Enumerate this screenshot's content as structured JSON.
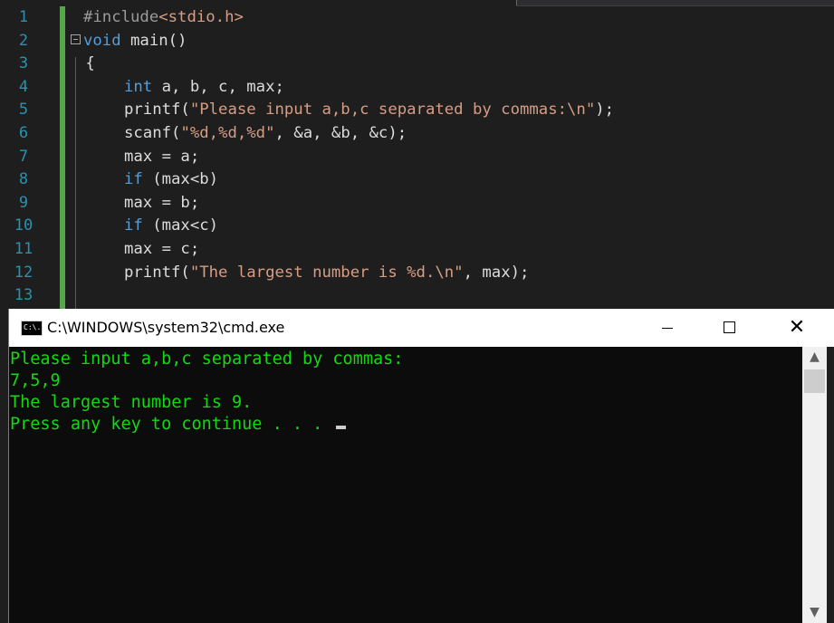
{
  "editor": {
    "line_numbers": [
      "1",
      "2",
      "3",
      "4",
      "5",
      "6",
      "7",
      "8",
      "9",
      "10",
      "11",
      "12",
      "13"
    ],
    "code": {
      "l1_directive": "#include",
      "l1_header": "<stdio.h>",
      "l2_void": "void",
      "l2_rest": " main()",
      "l3": " {",
      "l4_kw": "int",
      "l4_rest": " a, b, c, max;",
      "l5_fn": "printf(",
      "l5_str": "\"Please input a,b,c separated by commas:\\n\"",
      "l5_end": ");",
      "l6_fn": "scanf(",
      "l6_str": "\"%d,%d,%d\"",
      "l6_end": ", &a, &b, &c);",
      "l7": "max = a;",
      "l8_kw": "if",
      "l8_rest": " (max<b)",
      "l9": "max = b;",
      "l10_kw": "if",
      "l10_rest": " (max<c)",
      "l11": "max = c;",
      "l12_fn": "printf(",
      "l12_str": "\"The largest number is %d.\\n\"",
      "l12_end": ", max);",
      "l13": ""
    }
  },
  "console": {
    "title": "C:\\WINDOWS\\system32\\cmd.exe",
    "icon_text": "C:\\.",
    "minimize_icon": "minimize-icon",
    "maximize_icon": "maximize-icon",
    "close_symbol": "✕",
    "output": [
      "Please input a,b,c separated by commas:",
      "7,5,9",
      "The largest number is 9.",
      "Press any key to continue . . . "
    ],
    "scroll_up": "▲",
    "scroll_down": "▼"
  },
  "colors": {
    "editor_bg": "#1e1e1e",
    "keyword": "#569cd6",
    "string": "#d69d85",
    "line_number": "#2b91af",
    "console_text": "#13d813",
    "console_bg": "#0c0c0c"
  }
}
